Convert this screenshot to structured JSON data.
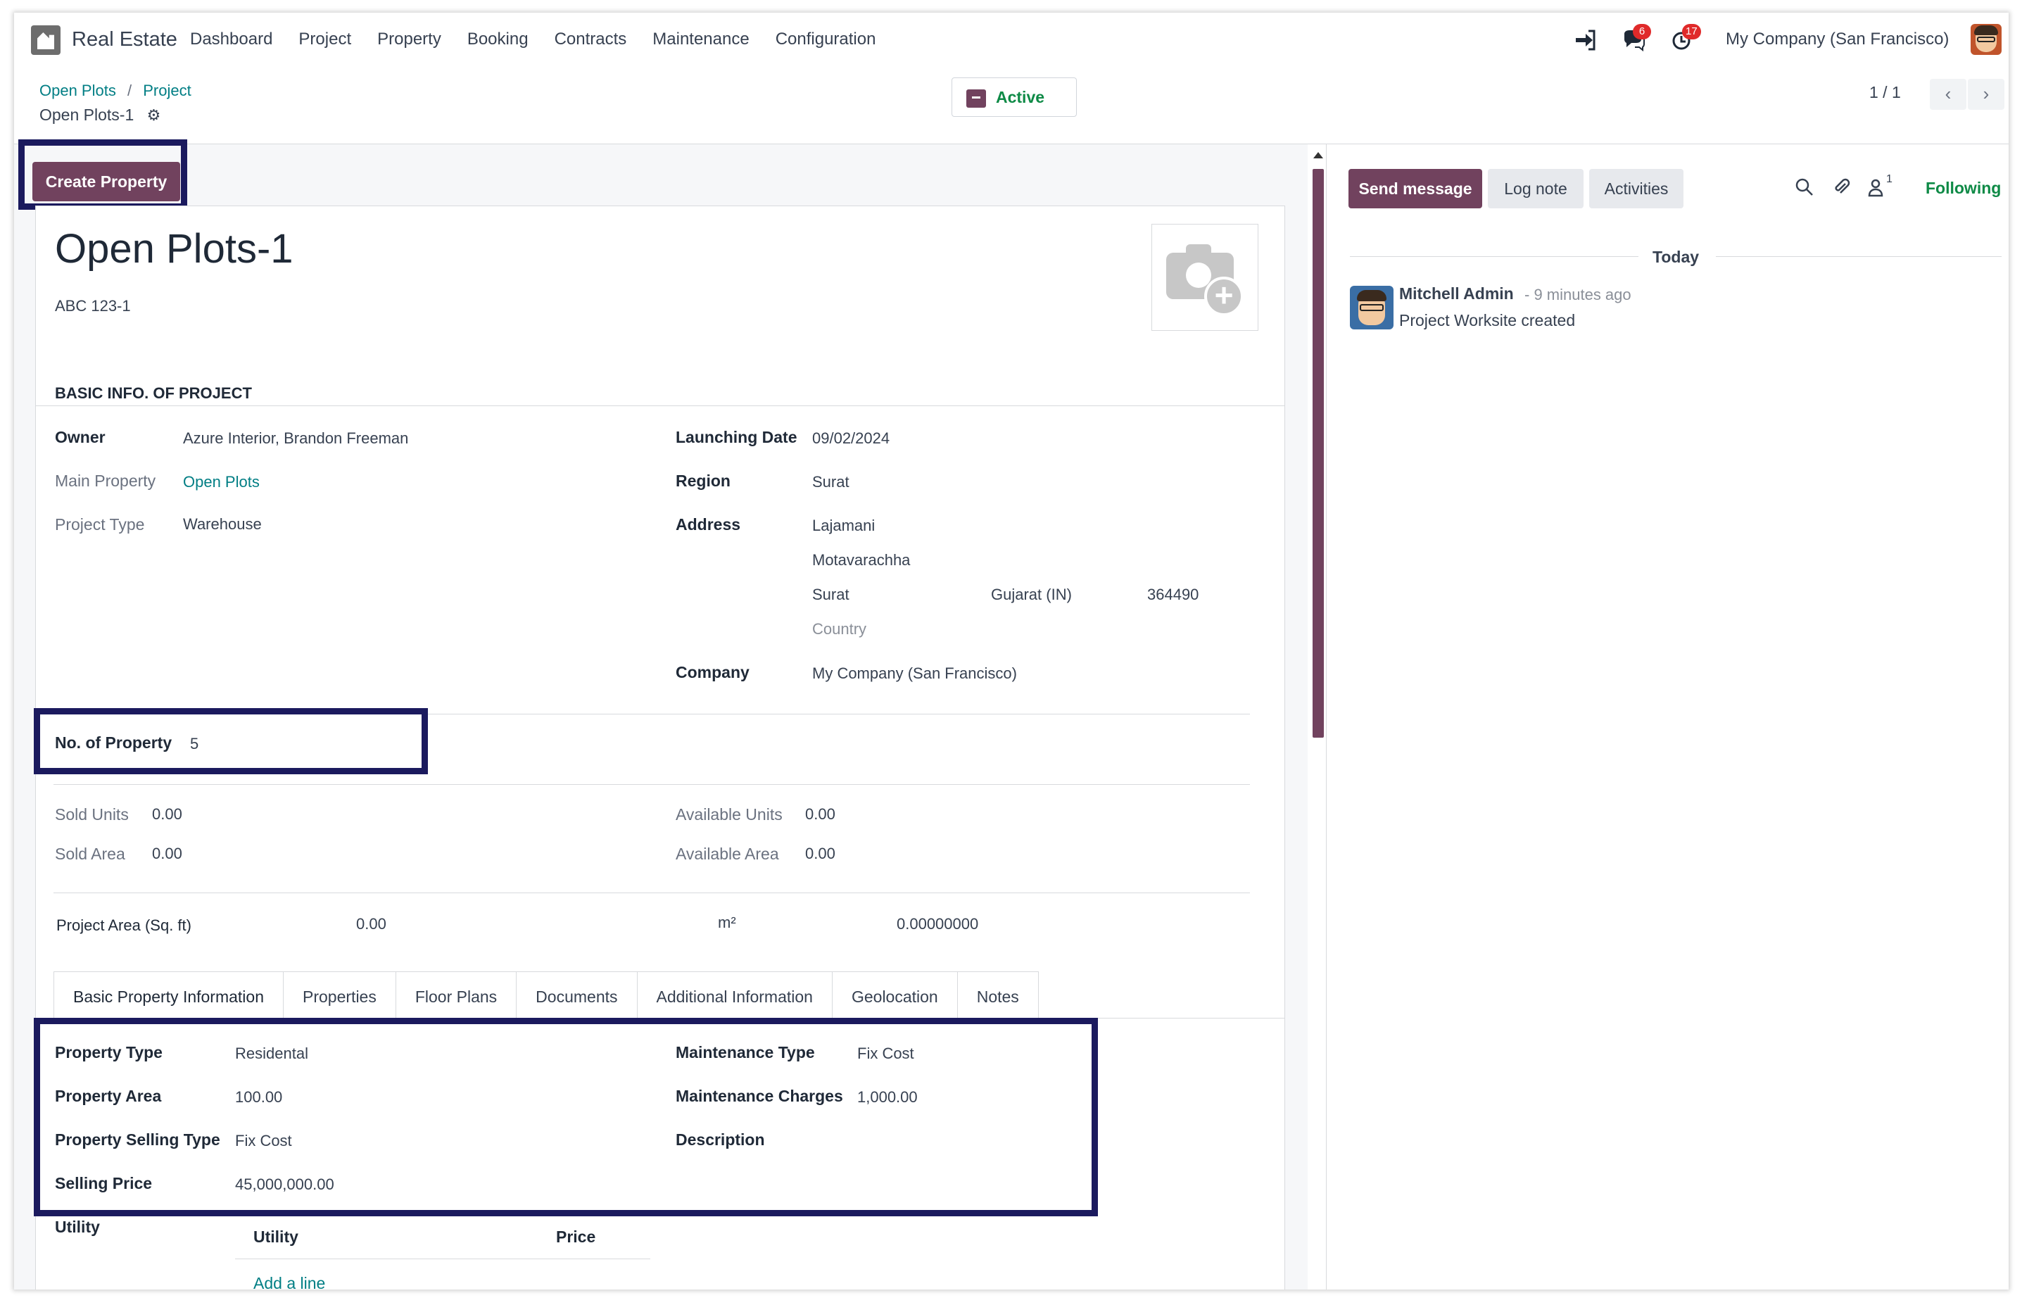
{
  "app": {
    "name": "Real Estate"
  },
  "menu": [
    "Dashboard",
    "Project",
    "Property",
    "Booking",
    "Contracts",
    "Maintenance",
    "Configuration"
  ],
  "systray": {
    "messages_count": "6",
    "activities_count": "17",
    "company": "My Company (San Francisco)"
  },
  "breadcrumb": {
    "root": "Open Plots",
    "sep": "/",
    "parent": "Project",
    "current": "Open Plots-1"
  },
  "status_button": {
    "label": "Active"
  },
  "pager": {
    "value": "1 / 1"
  },
  "actions": {
    "create_property": "Create Property"
  },
  "record": {
    "title": "Open Plots-1",
    "code": "ABC 123-1"
  },
  "basic_info": {
    "heading": "BASIC INFO. OF PROJECT",
    "owner_label": "Owner",
    "owner": "Azure Interior, Brandon Freeman",
    "main_property_label": "Main Property",
    "main_property": "Open Plots",
    "project_type_label": "Project Type",
    "project_type": "Warehouse",
    "launching_date_label": "Launching Date",
    "launching_date": "09/02/2024",
    "region_label": "Region",
    "region": "Surat",
    "address_label": "Address",
    "street": "Lajamani",
    "street2": "Motavarachha",
    "city": "Surat",
    "state": "Gujarat (IN)",
    "zip": "364490",
    "country_placeholder": "Country",
    "company_label": "Company",
    "company": "My Company (San Francisco)"
  },
  "counts": {
    "no_of_property_label": "No. of Property",
    "no_of_property": "5",
    "sold_units_label": "Sold Units",
    "sold_units": "0.00",
    "sold_area_label": "Sold Area",
    "sold_area": "0.00",
    "available_units_label": "Available Units",
    "available_units": "0.00",
    "available_area_label": "Available Area",
    "available_area": "0.00",
    "project_area_label": "Project Area (Sq. ft)",
    "project_area": "0.00",
    "m2_label": "m²",
    "m2_value": "0.00000000"
  },
  "tabs": [
    "Basic Property Information",
    "Properties",
    "Floor Plans",
    "Documents",
    "Additional Information",
    "Geolocation",
    "Notes"
  ],
  "property_info": {
    "property_type_label": "Property Type",
    "property_type": "Residental",
    "property_area_label": "Property Area",
    "property_area": "100.00",
    "selling_type_label": "Property Selling Type",
    "selling_type": "Fix Cost",
    "selling_price_label": "Selling Price",
    "selling_price": "45,000,000.00",
    "maintenance_type_label": "Maintenance Type",
    "maintenance_type": "Fix Cost",
    "maintenance_charges_label": "Maintenance Charges",
    "maintenance_charges": "1,000.00",
    "description_label": "Description"
  },
  "utility": {
    "label": "Utility",
    "col_utility": "Utility",
    "col_price": "Price",
    "add_line": "Add a line"
  },
  "chatter": {
    "send_message": "Send message",
    "log_note": "Log note",
    "activities": "Activities",
    "followers_count": "1",
    "following": "Following",
    "date_separator": "Today",
    "messages": [
      {
        "author": "Mitchell Admin",
        "time": "- 9 minutes ago",
        "body": "Project Worksite created"
      }
    ]
  },
  "colors": {
    "primary": "#71425e",
    "link": "#017e84",
    "success": "#0e8a46",
    "highlight": "#1b1a5e",
    "badge": "#e02a2a"
  }
}
